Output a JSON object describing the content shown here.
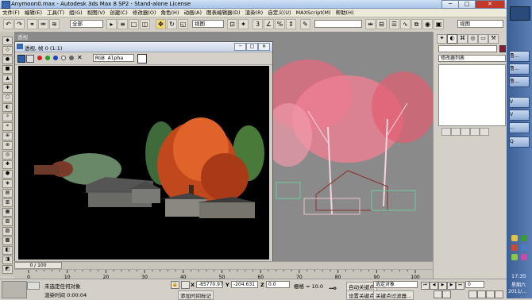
{
  "window": {
    "title": "Anymoon0.max - Autodesk 3ds Max 8 SP2 - Stand-alone License",
    "min_label": "─",
    "max_label": "□",
    "close_label": "✕",
    "close_color": "#c0392b"
  },
  "menubar": [
    "文件(F)",
    "编辑(E)",
    "工具(T)",
    "组(G)",
    "视图(V)",
    "创建(C)",
    "修改器(O)",
    "角色(H)",
    "动画(A)",
    "图表编辑器(D)",
    "渲染(R)",
    "自定义(U)",
    "MAXScript(M)",
    "帮助(H)"
  ],
  "toolbar": {
    "selection_filter": "全部",
    "reference_coord": "视图",
    "named_selection": "",
    "view_dropdown": "视图"
  },
  "viewport": {
    "label": "透视"
  },
  "render_frame": {
    "title": "透视, 帧 0 (1:1)",
    "channel": "RGB Alpha",
    "swatch_color": "#ffffff"
  },
  "time_slider": {
    "position": "0 / 100",
    "frame": 0,
    "total": 100
  },
  "timeline": {
    "ticks": [
      "0",
      "10",
      "20",
      "30",
      "40",
      "50",
      "60",
      "70",
      "80",
      "90",
      "100"
    ]
  },
  "command_panel": {
    "modifier_list": "修改器列表",
    "color_swatch": "#8b1a3a"
  },
  "status": {
    "prompt": "未选定任何对象",
    "render_time": "渲染时间  0:00:04",
    "add_time_tag": "添加时间标记",
    "x_label": "X",
    "x_value": "-85770.97",
    "y_label": "Y",
    "y_value": "-204.631",
    "z_label": "Z",
    "z_value": "0.0",
    "grid": "栅格 = 10.0",
    "auto_key": "自动关键点",
    "set_key": "设置关键点",
    "key_filters": "关键点过滤器...",
    "selected_object": "选定对象",
    "frame_value": "0"
  },
  "taskbar": {
    "items": [
      "鲁...",
      "鲁...",
      "鲁...",
      "V",
      "V",
      "...",
      "Q"
    ],
    "clock_time": "17:35",
    "clock_day": "星期六",
    "clock_date": "2011/..."
  }
}
